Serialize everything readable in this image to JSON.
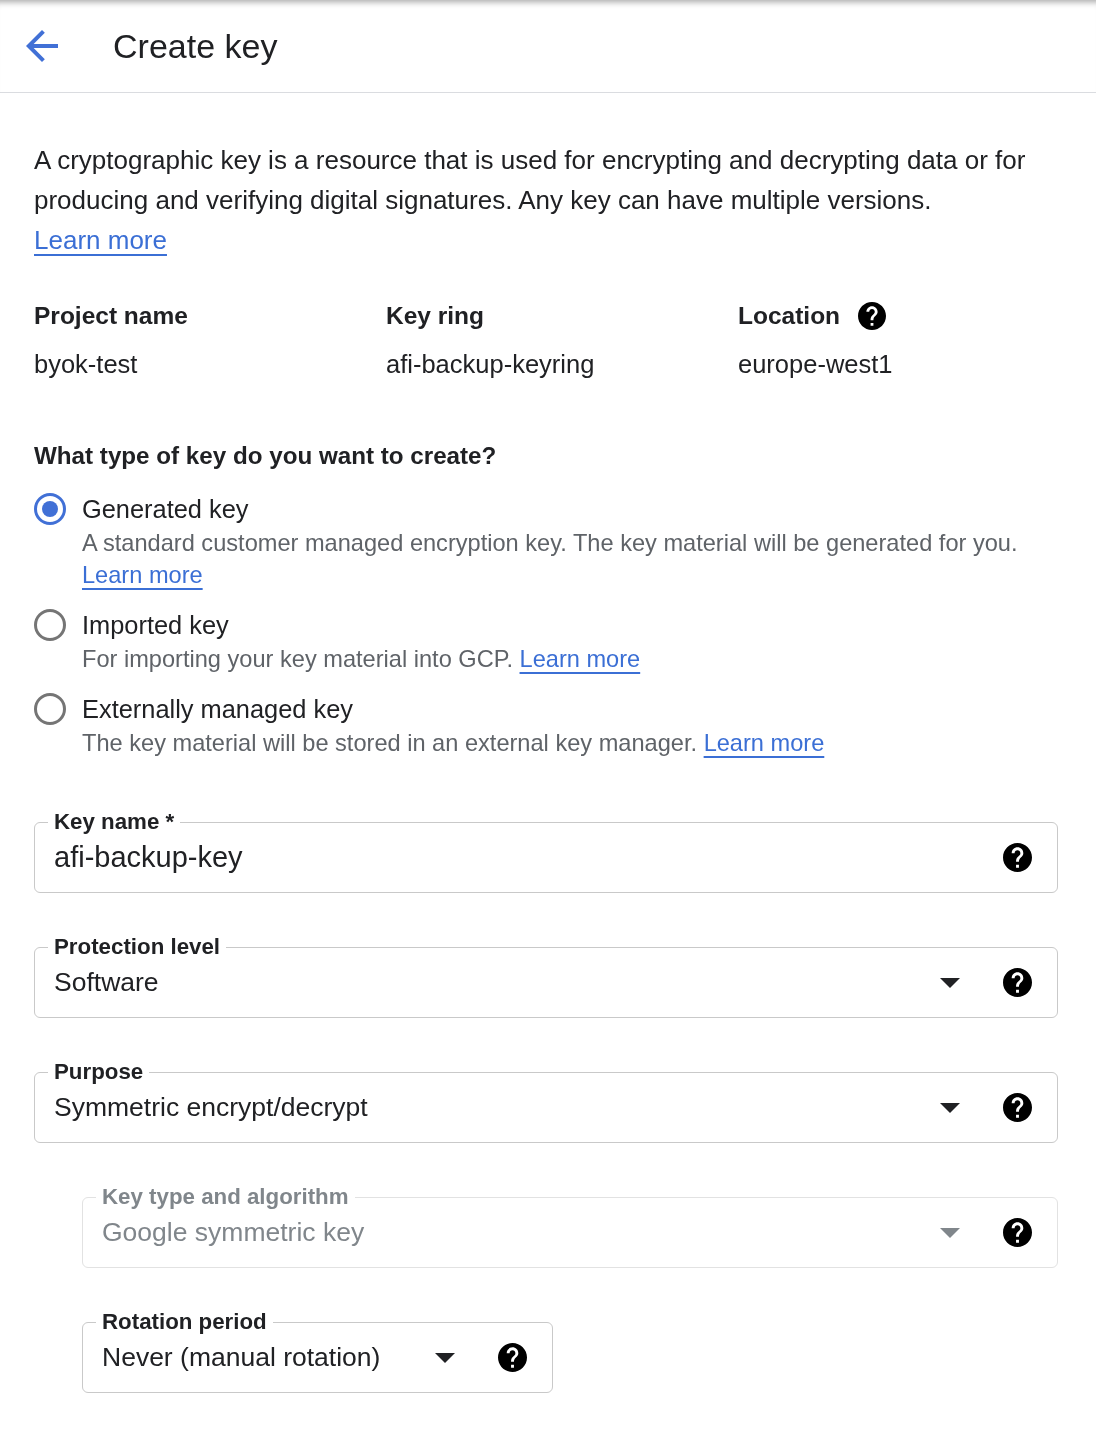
{
  "header": {
    "title": "Create key"
  },
  "intro": {
    "text": "A cryptographic key is a resource that is used for encrypting and decrypting data or for producing and verifying digital signatures. Any key can have multiple versions.",
    "link": "Learn more"
  },
  "details": [
    {
      "label": "Project name",
      "value": "byok-test",
      "help": false
    },
    {
      "label": "Key ring",
      "value": "afi-backup-keyring",
      "help": false
    },
    {
      "label": "Location",
      "value": "europe-west1",
      "help": true
    }
  ],
  "key_type": {
    "question": "What type of key do you want to create?",
    "options": [
      {
        "label": "Generated key",
        "description": "A standard customer managed encryption key. The key material will be generated for you.",
        "link": "Learn more",
        "selected": true
      },
      {
        "label": "Imported key",
        "description": "For importing your key material into GCP.",
        "link": "Learn more",
        "selected": false
      },
      {
        "label": "Externally managed key",
        "description": "The key material will be stored in an external key manager.",
        "link": "Learn more",
        "selected": false
      }
    ]
  },
  "fields": [
    {
      "kind": "text",
      "label": "Key name *",
      "value": "afi-backup-key",
      "disabled": false
    },
    {
      "kind": "select",
      "label": "Protection level",
      "value": "Software",
      "disabled": false
    },
    {
      "kind": "select",
      "label": "Purpose",
      "value": "Symmetric encrypt/decrypt",
      "disabled": false,
      "children": [
        {
          "kind": "select",
          "label": "Key type and algorithm",
          "value": "Google symmetric key",
          "disabled": true
        },
        {
          "kind": "select",
          "label": "Rotation period",
          "value": "Never (manual rotation)",
          "disabled": false
        }
      ]
    }
  ]
}
